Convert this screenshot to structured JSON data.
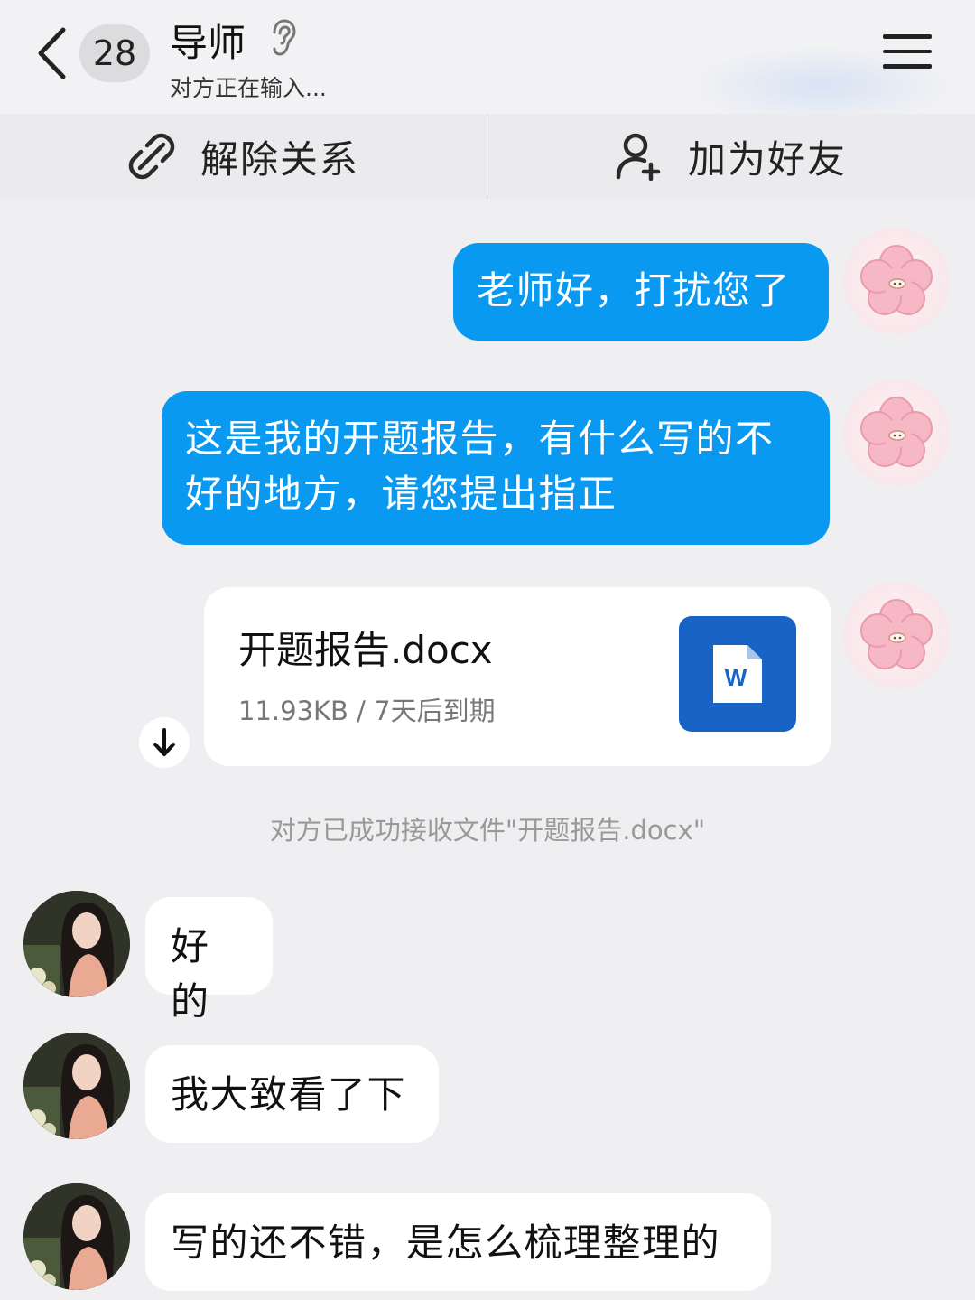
{
  "header": {
    "unread_count": "28",
    "contact_name": "导师",
    "status": "对方正在输入..."
  },
  "action_bar": {
    "unlink_label": "解除关系",
    "add_friend_label": "加为好友"
  },
  "messages": [
    {
      "direction": "outgoing",
      "text": "老师好，打扰您了"
    },
    {
      "direction": "outgoing",
      "text": "这是我的开题报告，有什么写的不好的地方，请您提出指正"
    },
    {
      "direction": "outgoing",
      "type": "file",
      "file_name": "开题报告.docx",
      "file_meta": "11.93KB / 7天后到期",
      "file_icon_letter": "W"
    },
    {
      "direction": "system",
      "text": "对方已成功接收文件\"开题报告.docx\""
    },
    {
      "direction": "incoming",
      "text": "好的"
    },
    {
      "direction": "incoming",
      "text": "我大致看了下"
    },
    {
      "direction": "incoming",
      "text": "写的还不错，是怎么梳理整理的"
    }
  ],
  "colors": {
    "outgoing_bubble": "#0a99f0",
    "incoming_bubble": "#ffffff",
    "background": "#efeff1",
    "word_icon": "#1864c6"
  },
  "icons": [
    "back-icon",
    "ear-icon",
    "menu-icon",
    "unlink-icon",
    "add-user-icon",
    "word-doc-icon",
    "download-icon"
  ]
}
